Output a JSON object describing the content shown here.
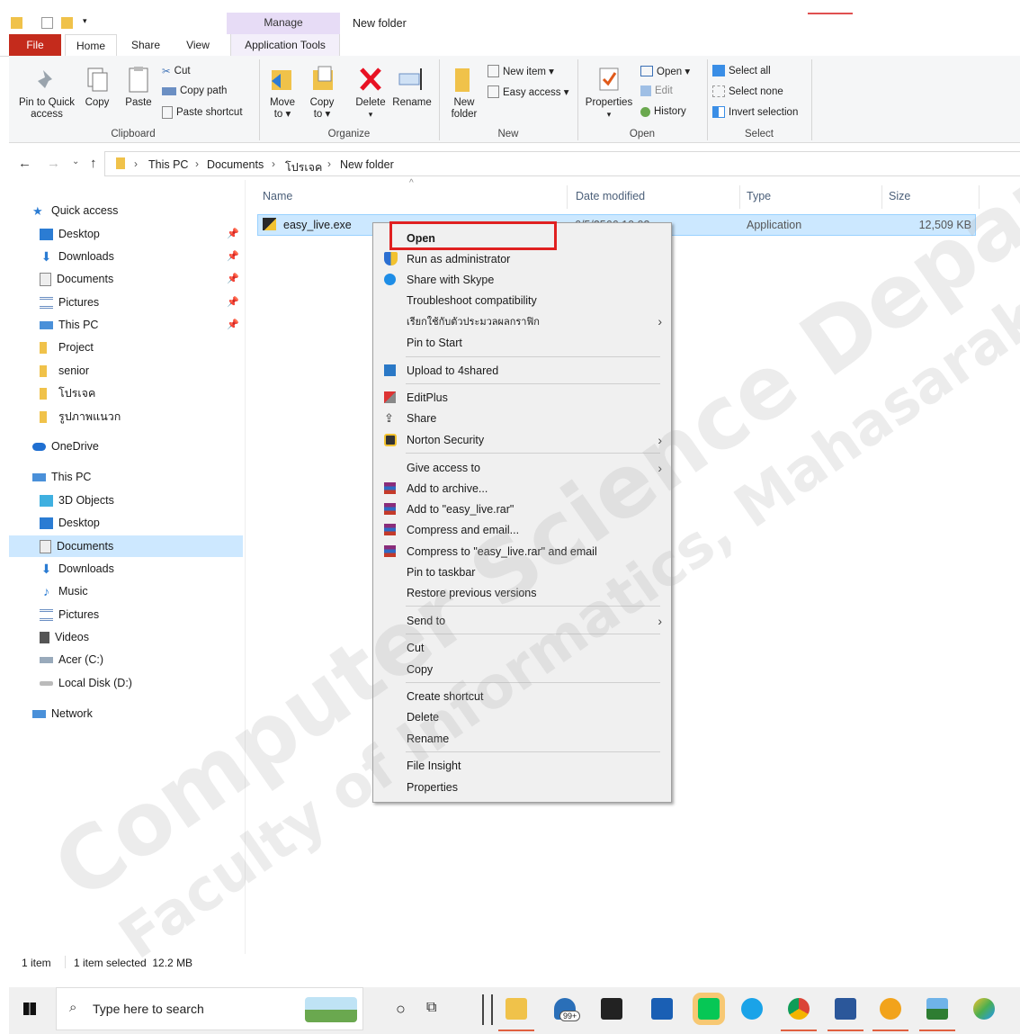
{
  "titlebar": {
    "manage_label": "Manage",
    "window_title": "New folder"
  },
  "tabs": [
    "File",
    "Home",
    "Share",
    "View",
    "Application Tools"
  ],
  "ribbon": {
    "clipboard": {
      "pin_label_1": "Pin to Quick",
      "pin_label_2": "access",
      "copy": "Copy",
      "paste": "Paste",
      "cut": "Cut",
      "copy_path": "Copy path",
      "paste_shortcut": "Paste shortcut",
      "group": "Clipboard"
    },
    "organize": {
      "move_to_1": "Move",
      "move_to_2": "to ▾",
      "copy_to_1": "Copy",
      "copy_to_2": "to ▾",
      "delete": "Delete",
      "rename": "Rename",
      "group": "Organize"
    },
    "new": {
      "new_folder_1": "New",
      "new_folder_2": "folder",
      "new_item": "New item ▾",
      "easy_access": "Easy access ▾",
      "group": "New"
    },
    "open": {
      "properties": "Properties",
      "open": "Open ▾",
      "edit": "Edit",
      "history": "History",
      "group": "Open"
    },
    "select": {
      "select_all": "Select all",
      "select_none": "Select none",
      "invert": "Invert selection",
      "group": "Select"
    }
  },
  "breadcrumb": [
    "This PC",
    "Documents",
    "โปรเจค",
    "New folder"
  ],
  "nav": {
    "quick_access": "Quick access",
    "quick_items": [
      "Desktop",
      "Downloads",
      "Documents",
      "Pictures",
      "This PC",
      "Project",
      "senior",
      "โปรเจค",
      "รูปภาพแนวก"
    ],
    "onedrive": "OneDrive",
    "this_pc": "This PC",
    "pc_items": [
      "3D Objects",
      "Desktop",
      "Documents",
      "Downloads",
      "Music",
      "Pictures",
      "Videos",
      "Acer (C:)",
      "Local Disk (D:)"
    ],
    "network": "Network"
  },
  "columns": {
    "name": "Name",
    "date": "Date modified",
    "type": "Type",
    "size": "Size"
  },
  "file": {
    "name": "easy_live.exe",
    "date": "6/5/2566 10:03",
    "type": "Application",
    "size": "12,509 KB"
  },
  "context_menu": {
    "open": "Open",
    "run_admin": "Run as administrator",
    "skype": "Share with Skype",
    "troubleshoot": "Troubleshoot compatibility",
    "graphics": "เรียกใช้กับตัวประมวลผลกราฟิก",
    "pin_start": "Pin to Start",
    "upload": "Upload to 4shared",
    "editplus": "EditPlus",
    "share": "Share",
    "norton": "Norton Security",
    "give_access": "Give access to",
    "add_archive": "Add to archive...",
    "add_rar": "Add to \"easy_live.rar\"",
    "compress_email": "Compress and email...",
    "compress_rar_email": "Compress to \"easy_live.rar\" and email",
    "pin_taskbar": "Pin to taskbar",
    "restore": "Restore previous versions",
    "send_to": "Send to",
    "cut": "Cut",
    "copy": "Copy",
    "create_shortcut": "Create shortcut",
    "delete": "Delete",
    "rename": "Rename",
    "file_insight": "File Insight",
    "properties": "Properties"
  },
  "status": {
    "count": "1 item",
    "selected": "1 item selected  12.2 MB"
  },
  "taskbar": {
    "search_placeholder": "Type here to search",
    "mail_badge": "99+"
  },
  "watermark": {
    "line1": "Computer Science Department",
    "line2": "Faculty of Informatics, Mahasarakham University"
  },
  "colors": {
    "accent": "#0078d4",
    "file_tab": "#c42b1c",
    "highlight_box": "#e02020",
    "selection": "#cce8ff"
  }
}
